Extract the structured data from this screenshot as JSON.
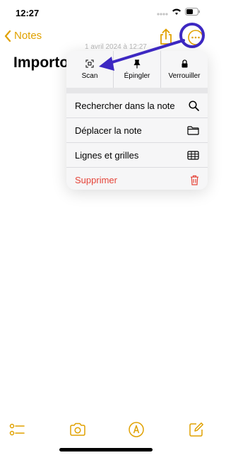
{
  "status_bar": {
    "time": "12:27"
  },
  "nav": {
    "back_label": "Notes"
  },
  "note": {
    "title_partial": "Importo",
    "date_faint": "1 avril 2024 à 12:27"
  },
  "menu": {
    "top_actions": [
      {
        "label": "Scan",
        "icon": "scan-icon"
      },
      {
        "label": "Épingler",
        "icon": "pin-icon"
      },
      {
        "label": "Verrouiller",
        "icon": "lock-icon"
      }
    ],
    "items": [
      {
        "label": "Rechercher dans la note",
        "icon": "search-icon"
      },
      {
        "label": "Déplacer la note",
        "icon": "folder-icon"
      },
      {
        "label": "Lignes et grilles",
        "icon": "grid-icon"
      },
      {
        "label": "Supprimer",
        "icon": "trash-icon",
        "destructive": true
      }
    ]
  },
  "colors": {
    "accent": "#e0a100",
    "annotation": "#3d28c2",
    "destructive": "#e5453a",
    "menu_background": "#f6f6f7"
  },
  "toolbar": {
    "icons": [
      "checklist-icon",
      "camera-icon",
      "markup-icon",
      "compose-icon"
    ]
  }
}
